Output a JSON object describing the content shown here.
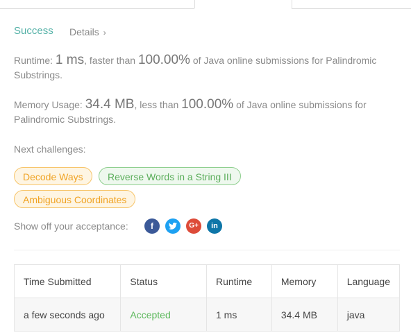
{
  "status": {
    "label": "Success",
    "details_label": "Details"
  },
  "runtime": {
    "prefix": "Runtime: ",
    "value": "1 ms",
    "middle": ", faster than ",
    "percent": "100.00%",
    "suffix": " of Java online submissions for Palindromic Substrings."
  },
  "memory": {
    "prefix": "Memory Usage: ",
    "value": "34.4 MB",
    "middle": ", less than ",
    "percent": "100.00%",
    "suffix": " of Java online submissions for Palindromic Substrings."
  },
  "next": {
    "label": "Next challenges:",
    "challenges": [
      "Decode Ways",
      "Reverse Words in a String III",
      "Ambiguous Coordinates"
    ]
  },
  "share": {
    "label": "Show off your acceptance:",
    "icons": [
      "facebook-icon",
      "twitter-icon",
      "google-plus-icon",
      "linkedin-icon"
    ]
  },
  "table": {
    "headers": [
      "Time Submitted",
      "Status",
      "Runtime",
      "Memory",
      "Language"
    ],
    "rows": [
      [
        "a few seconds ago",
        "Accepted",
        "1 ms",
        "34.4 MB",
        "java"
      ]
    ]
  },
  "colors": {
    "success": "#54b1a7",
    "accepted": "#5cb85c",
    "orange": "#f0a324",
    "green": "#5cae5c"
  }
}
